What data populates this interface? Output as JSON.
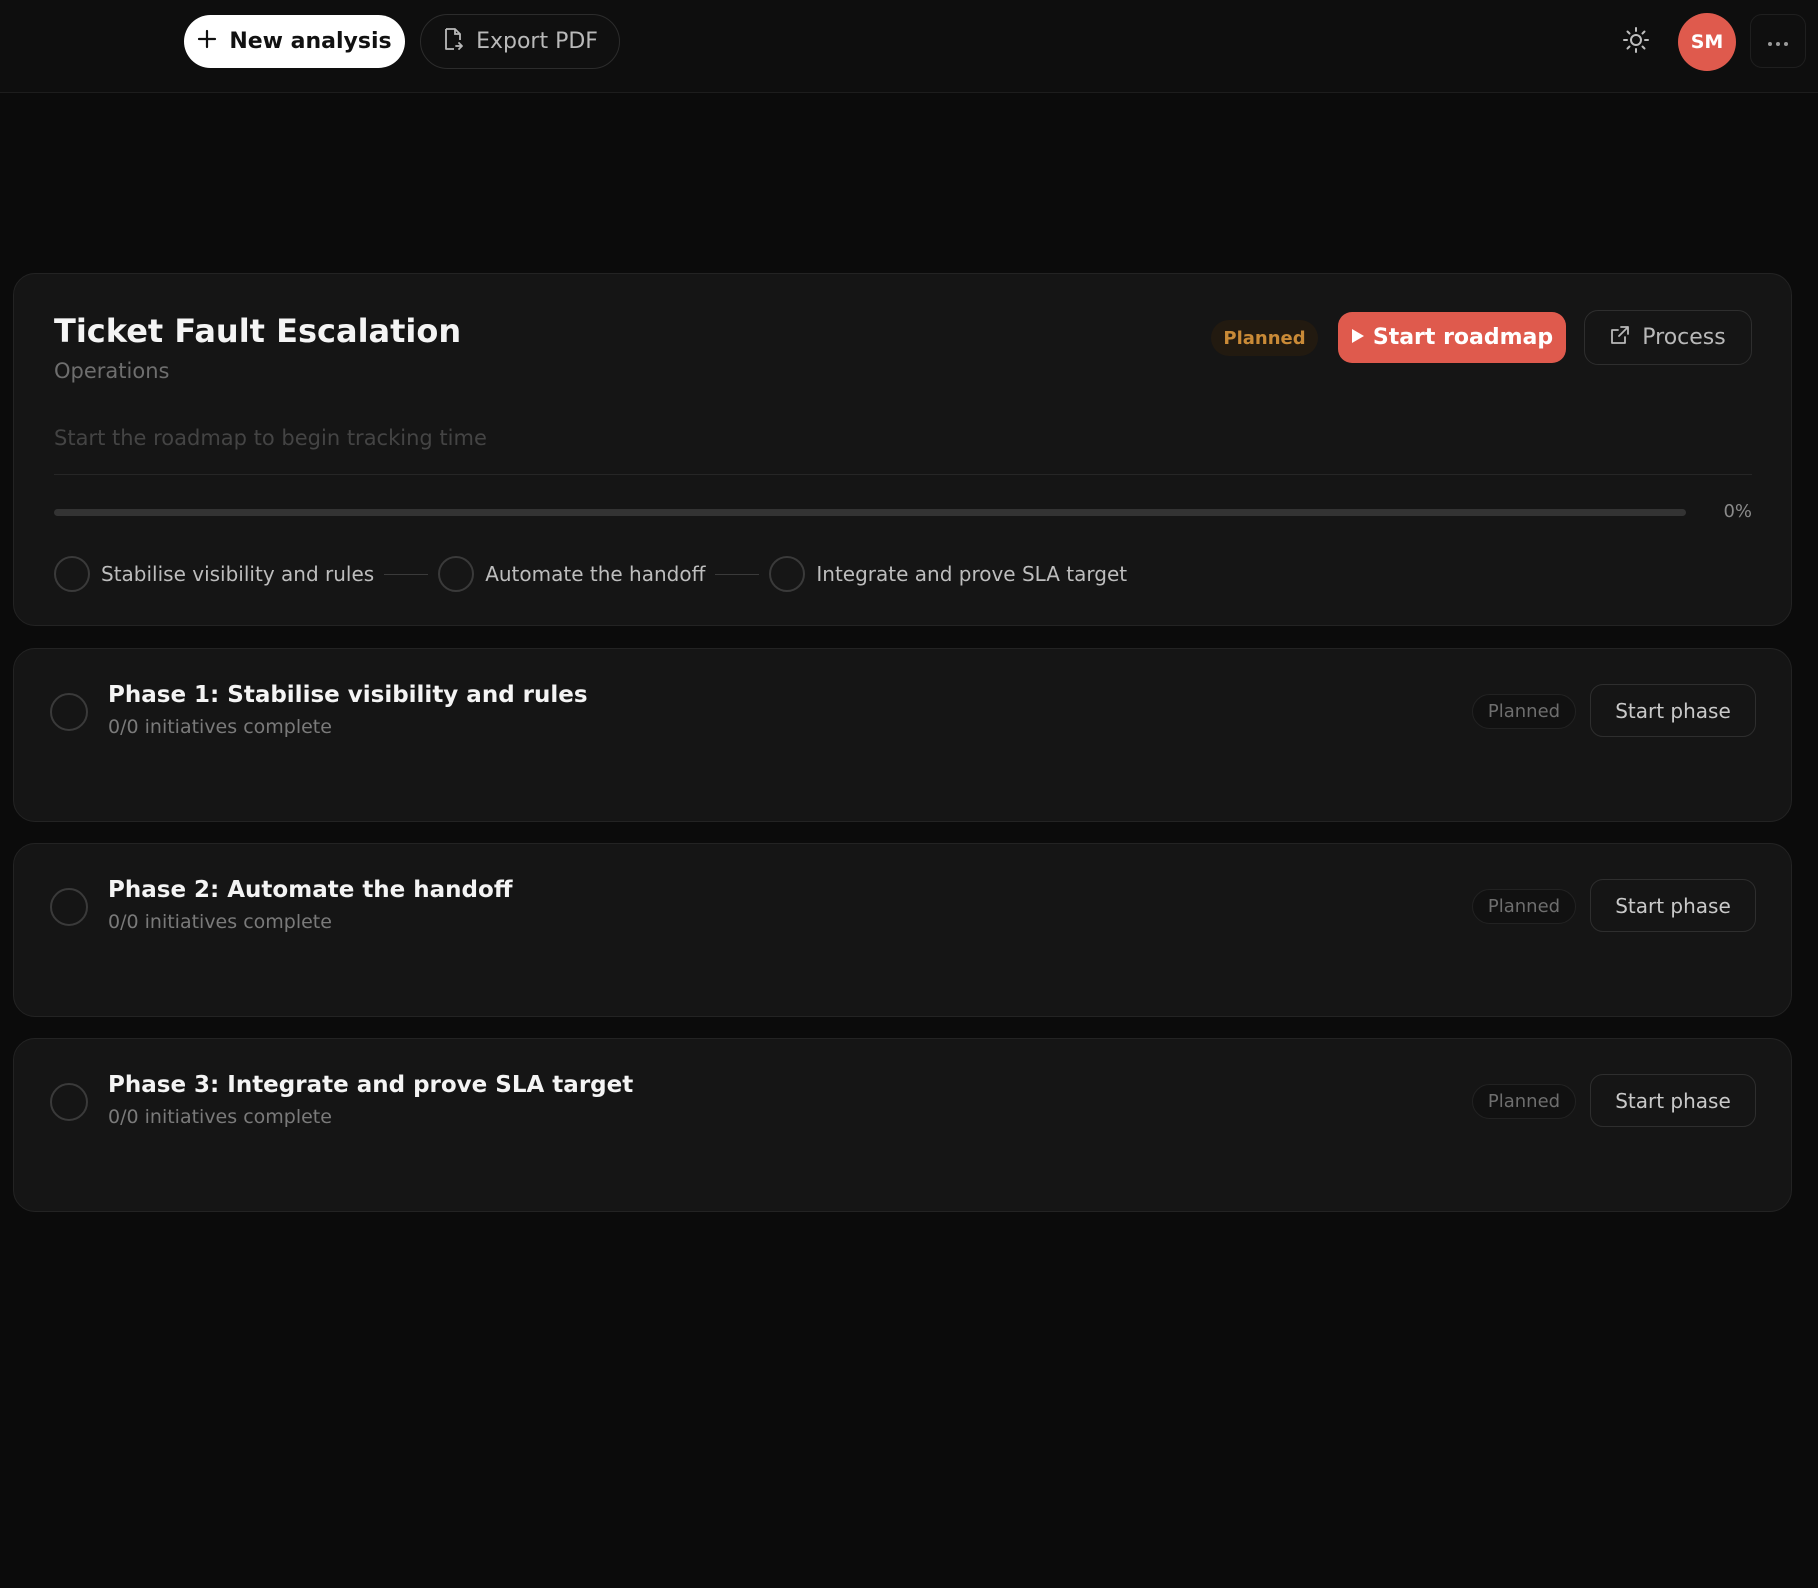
{
  "toolbar": {
    "new_analysis_label": "New analysis",
    "new_analysis_icon": "plus-icon",
    "export_label": "Export PDF",
    "export_icon": "file-export-icon",
    "theme_icon": "sun-icon",
    "avatar_initials": "SM",
    "more_icon": "ellipsis-icon"
  },
  "roadmap": {
    "title": "Ticket Fault Escalation",
    "subtitle": "Operations",
    "status": "Planned",
    "start_label": "Start roadmap",
    "start_icon": "play-icon",
    "process_label": "Process",
    "process_icon": "external-link-icon",
    "hint": "Start the roadmap to begin tracking time",
    "progress_value": 0,
    "progress_label": "0%",
    "steps": [
      {
        "label": "Stabilise visibility and rules"
      },
      {
        "label": "Automate the handoff"
      },
      {
        "label": "Integrate and prove SLA target"
      }
    ]
  },
  "phases": [
    {
      "title": "Phase 1: Stabilise visibility and rules",
      "progress": "0/0 initiatives complete",
      "status": "Planned",
      "action": "Start phase"
    },
    {
      "title": "Phase 2: Automate the handoff",
      "progress": "0/0 initiatives complete",
      "status": "Planned",
      "action": "Start phase"
    },
    {
      "title": "Phase 3: Integrate and prove SLA target",
      "progress": "0/0 initiatives complete",
      "status": "Planned",
      "action": "Start phase"
    }
  ],
  "colors": {
    "accent": "#df5a4d",
    "background": "#0b0b0b",
    "card": "#151515",
    "planned_badge_text": "#c98a37"
  }
}
